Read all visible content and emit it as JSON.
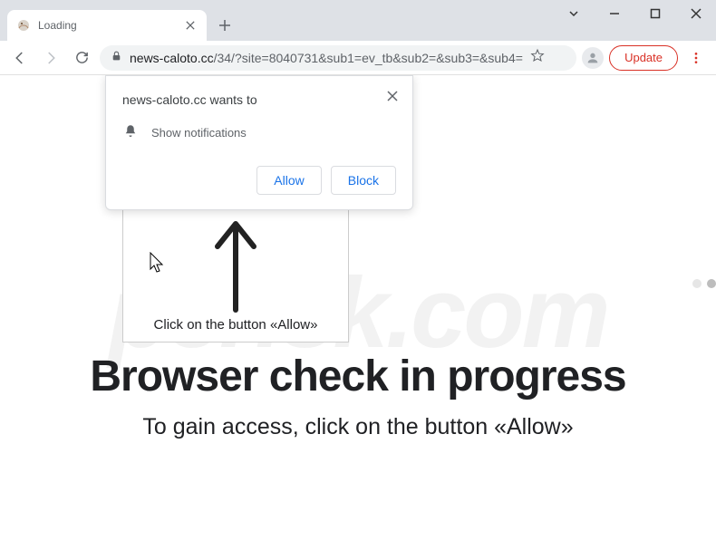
{
  "window": {
    "tab_title": "Loading",
    "url_domain": "news-caloto.cc",
    "url_path": "/34/?site=8040731&sub1=ev_tb&sub2=&sub3=&sub4=",
    "update_label": "Update"
  },
  "permission": {
    "title": "news-caloto.cc wants to",
    "item": "Show notifications",
    "allow": "Allow",
    "block": "Block"
  },
  "page": {
    "box_text": "Click on the button «Allow»",
    "headline": "Browser check in progress",
    "subhead": "To gain access, click on the button «Allow»"
  },
  "watermark": "pcrisk.com"
}
